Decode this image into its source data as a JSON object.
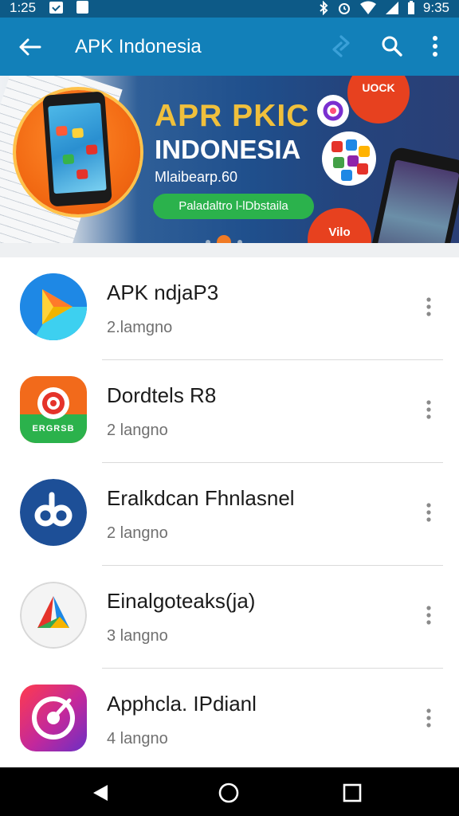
{
  "status_bar": {
    "time": "1:25",
    "clock": "9:35"
  },
  "app_bar": {
    "title": "APK Indonesia",
    "icons": [
      "back-arrow-icon",
      "sync-icon",
      "search-icon",
      "more-vert-icon"
    ]
  },
  "banner": {
    "title_line1": "APR PKIC",
    "title_line2": "INDONESIA",
    "subtitle": "Mlaibearp.60",
    "cta_label": "Paladaltro l-lDbstaila",
    "badge_top": "UOCK",
    "badge_bottom": "Vilo",
    "colors": {
      "accent_orange": "#f26a13",
      "title_gold": "#f0c03c",
      "cta_green": "#2bb24c",
      "navy": "#1f4f8c"
    }
  },
  "apps": [
    {
      "name": "APK ndjaP3",
      "meta": "2.lamgno",
      "icon": "play-arrow-icon"
    },
    {
      "name": "Dordtels R8",
      "meta": "2 langno",
      "icon": "target-icon",
      "icon_caption": "ERGRSB"
    },
    {
      "name": "Eralkdcan Fhnlasnel",
      "meta": "2 langno",
      "icon": "link-icon"
    },
    {
      "name": "Einalgoteaks(ja)",
      "meta": "3 langno",
      "icon": "triangle-logo-icon"
    },
    {
      "name": "Apphcla. IPdianl",
      "meta": "4 langno",
      "icon": "disc-icon"
    }
  ],
  "nav_bar": {
    "icons": [
      "back-triangle-icon",
      "home-circle-icon",
      "recents-square-icon"
    ]
  },
  "colors": {
    "status_bar": "#0d5a87",
    "app_bar": "#1280b9",
    "separator": "#dadada",
    "nav_bar": "#000000"
  }
}
